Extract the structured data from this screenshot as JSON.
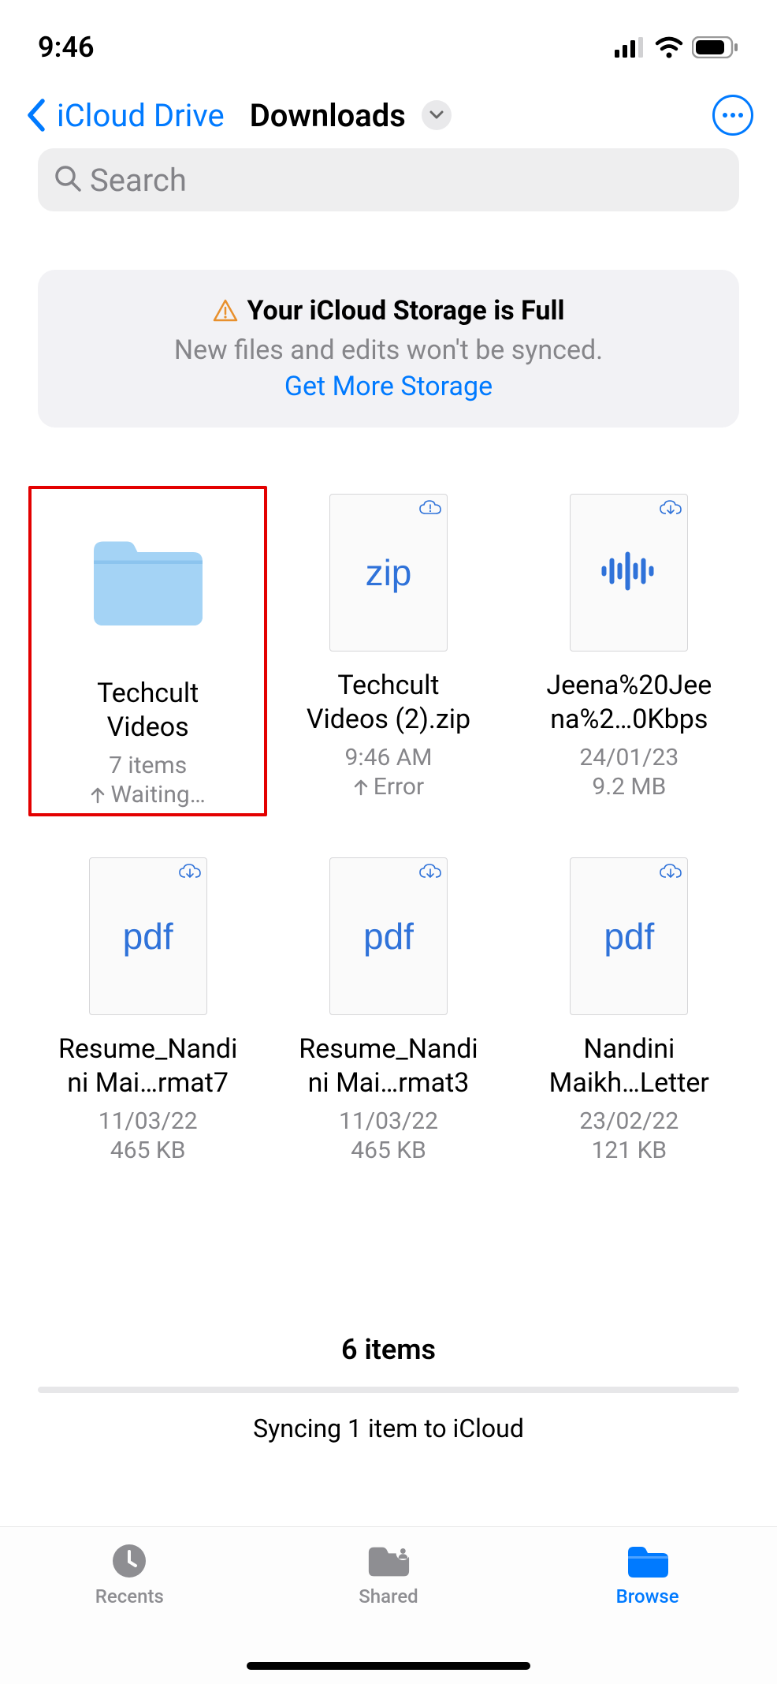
{
  "statusbar": {
    "time": "9:46"
  },
  "nav": {
    "back_label": "iCloud Drive",
    "title": "Downloads"
  },
  "search": {
    "placeholder": "Search"
  },
  "banner": {
    "title": "Your iCloud Storage is Full",
    "subtitle": "New files and edits won't be synced.",
    "link": "Get More Storage"
  },
  "items": [
    {
      "kind": "folder",
      "name_line1": "Techcult",
      "name_line2": "Videos",
      "meta1": "7 items",
      "meta2": "Waiting…",
      "meta2_arrow": true,
      "highlighted": true
    },
    {
      "kind": "zip",
      "name_line1": "Techcult",
      "name_line2": "Videos (2).zip",
      "meta1": "9:46 AM",
      "meta2": "Error",
      "meta2_arrow": true,
      "cloud": "alert"
    },
    {
      "kind": "audio",
      "name_line1": "Jeena%20Jee",
      "name_line2": "na%2…0Kbps",
      "meta1": "24/01/23",
      "meta2": "9.2 MB",
      "cloud": "download"
    },
    {
      "kind": "pdf",
      "name_line1": "Resume_Nandi",
      "name_line2": "ni Mai…rmat7",
      "meta1": "11/03/22",
      "meta2": "465 KB",
      "cloud": "download"
    },
    {
      "kind": "pdf",
      "name_line1": "Resume_Nandi",
      "name_line2": "ni Mai…rmat3",
      "meta1": "11/03/22",
      "meta2": "465 KB",
      "cloud": "download"
    },
    {
      "kind": "pdf",
      "name_line1": "Nandini",
      "name_line2": "Maikh…Letter",
      "meta1": "23/02/22",
      "meta2": "121 KB",
      "cloud": "download"
    }
  ],
  "footer": {
    "count": "6 items",
    "sync_text": "Syncing 1 item to iCloud"
  },
  "tabs": {
    "recents": "Recents",
    "shared": "Shared",
    "browse": "Browse"
  }
}
